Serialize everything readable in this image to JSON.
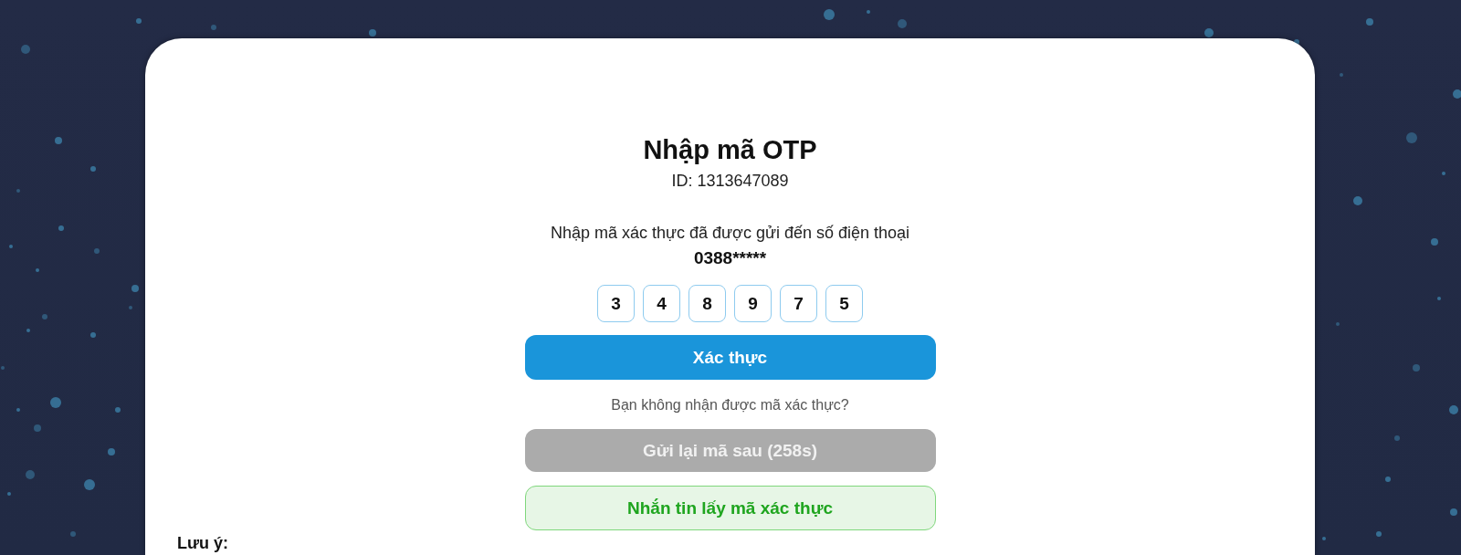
{
  "title": "Nhập mã OTP",
  "account_id": "ID: 1313647089",
  "instruction": {
    "text": "Nhập mã xác thực đã được gửi đến số điện thoại",
    "phone": "0388*****"
  },
  "otp_digits": [
    "3",
    "4",
    "8",
    "9",
    "7",
    "5"
  ],
  "verify_button": {
    "label": "Xác thực"
  },
  "resend_prompt": "Bạn không nhận được mã xác thực?",
  "resend_button": {
    "label": "Gửi lại mã sau (258s)",
    "disabled": true
  },
  "sms_button": {
    "label": "Nhắn tin lấy mã xác thực"
  },
  "note": {
    "heading": "Lưu ý:"
  }
}
